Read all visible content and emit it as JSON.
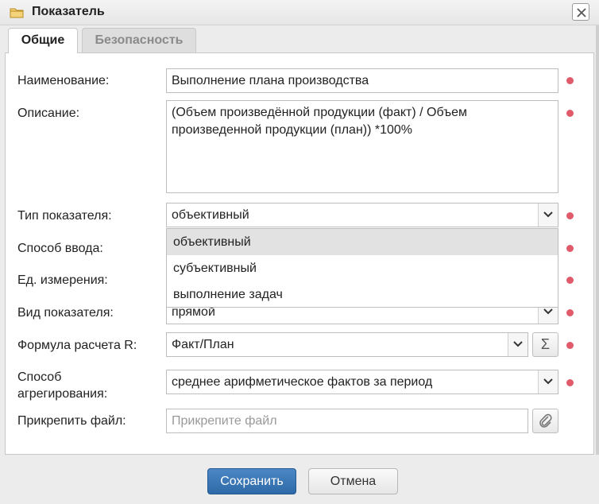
{
  "window": {
    "title": "Показатель",
    "icon": "folder-icon"
  },
  "tabs": [
    {
      "label": "Общие",
      "active": true
    },
    {
      "label": "Безопасность",
      "active": false
    }
  ],
  "form": {
    "name": {
      "label": "Наименование:",
      "value": "Выполнение плана производства",
      "required": true
    },
    "description": {
      "label": "Описание:",
      "value": "(Объем произведённой продукции (факт) / Объем произведенной продукции (план)) *100%",
      "required": true
    },
    "indicator_type": {
      "label": "Тип показателя:",
      "value": "объективный",
      "required": true,
      "options": [
        "объективный",
        "субъективный",
        "выполнение задач"
      ],
      "highlighted_option": "объективный"
    },
    "input_method": {
      "label": "Способ ввода:",
      "required": true
    },
    "unit": {
      "label": "Ед. измерения:",
      "required": true
    },
    "indicator_kind": {
      "label": "Вид показателя:",
      "value": "прямой",
      "required": true
    },
    "formula": {
      "label": "Формула расчета R:",
      "value": "Факт/План",
      "required": true,
      "formula_button_icon": "sigma-icon"
    },
    "aggregation": {
      "label_line1": "Способ",
      "label_line2": "агрегирования:",
      "value": "среднее арифметическое фактов за период",
      "required": true
    },
    "attachment": {
      "label": "Прикрепить файл:",
      "placeholder": "Прикрепите файл",
      "button_icon": "paperclip-icon"
    }
  },
  "buttons": {
    "save": "Сохранить",
    "cancel": "Отмена"
  },
  "colors": {
    "primary": "#2f6aa8",
    "required_marker": "#e05a6a"
  }
}
